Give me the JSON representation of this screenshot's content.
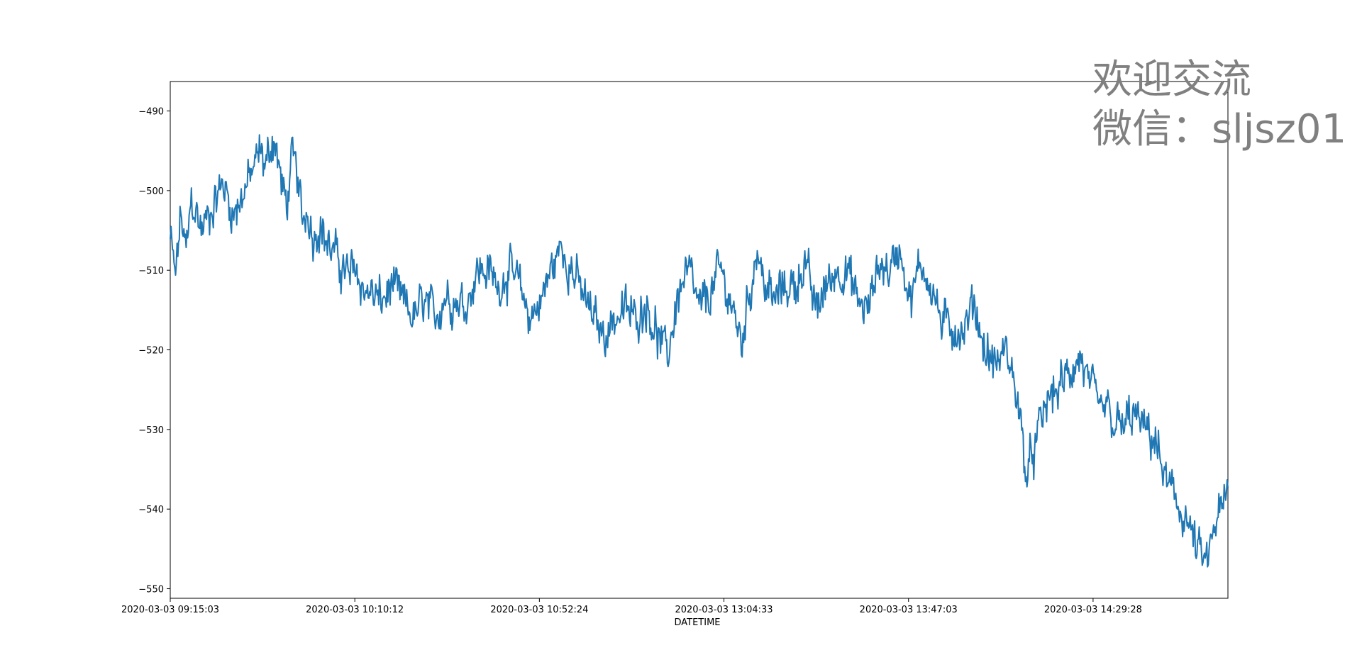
{
  "watermark": {
    "line1": "欢迎交流",
    "line2": "微信：sljsz01"
  },
  "colors": {
    "series": "#1f77b4",
    "axis": "#000000",
    "watermark": "#808080"
  },
  "chart_data": {
    "type": "line",
    "title": "",
    "xlabel": "DATETIME",
    "ylabel": "",
    "x_tick_labels": [
      "2020-03-03 09:15:03",
      "2020-03-03 10:10:12",
      "2020-03-03 10:52:24",
      "2020-03-03 13:04:33",
      "2020-03-03 13:47:03",
      "2020-03-03 14:29:28"
    ],
    "x_tick_positions": [
      0,
      0.1745,
      0.349,
      0.5235,
      0.698,
      0.8725
    ],
    "y_ticks": [
      -490,
      -500,
      -510,
      -520,
      -530,
      -540,
      -550
    ],
    "ylim": [
      -551.2,
      -486.3
    ],
    "grid": false,
    "legend": "none",
    "x_note": "x values are fractions of the plotted time span (trading-time index order)",
    "series": [
      {
        "x": [
          0,
          0.005,
          0.01,
          0.015,
          0.02,
          0.03,
          0.04,
          0.05,
          0.06,
          0.07,
          0.08,
          0.085,
          0.09,
          0.098,
          0.105,
          0.11,
          0.115,
          0.12,
          0.125,
          0.13,
          0.135,
          0.14,
          0.15,
          0.16,
          0.17,
          0.175,
          0.18,
          0.19,
          0.2,
          0.21,
          0.22,
          0.23,
          0.24,
          0.25,
          0.26,
          0.27,
          0.28,
          0.29,
          0.3,
          0.31,
          0.32,
          0.33,
          0.34,
          0.35,
          0.36,
          0.37,
          0.38,
          0.39,
          0.4,
          0.41,
          0.42,
          0.43,
          0.44,
          0.45,
          0.46,
          0.47,
          0.48,
          0.49,
          0.5,
          0.51,
          0.52,
          0.53,
          0.54,
          0.55,
          0.555,
          0.56,
          0.57,
          0.58,
          0.59,
          0.6,
          0.61,
          0.62,
          0.63,
          0.64,
          0.65,
          0.66,
          0.67,
          0.68,
          0.69,
          0.7,
          0.71,
          0.72,
          0.73,
          0.74,
          0.75,
          0.76,
          0.77,
          0.78,
          0.79,
          0.8,
          0.81,
          0.82,
          0.83,
          0.84,
          0.85,
          0.86,
          0.87,
          0.88,
          0.885,
          0.89,
          0.9,
          0.91,
          0.92,
          0.93,
          0.94,
          0.95,
          0.96,
          0.97,
          0.98,
          0.99,
          0.995,
          1.0
        ],
        "y": [
          -506,
          -511,
          -503,
          -508,
          -501,
          -505,
          -502,
          -499,
          -503,
          -500,
          -497,
          -495,
          -497,
          -493,
          -499,
          -502,
          -496,
          -498,
          -504,
          -502,
          -506,
          -504,
          -507,
          -509,
          -511,
          -509,
          -512,
          -513,
          -514,
          -512,
          -514,
          -516,
          -514,
          -516,
          -513,
          -514,
          -514,
          -510,
          -510,
          -512,
          -510,
          -512,
          -516,
          -514,
          -510,
          -507,
          -510,
          -513,
          -516,
          -518,
          -516,
          -515,
          -516,
          -514,
          -518,
          -521,
          -513,
          -510,
          -515,
          -513,
          -510,
          -514,
          -519,
          -511,
          -507,
          -511,
          -514,
          -512,
          -512,
          -509,
          -515,
          -512,
          -510,
          -510,
          -514,
          -515,
          -509,
          -510,
          -507,
          -514,
          -509,
          -512,
          -517,
          -517,
          -518,
          -514,
          -520,
          -522,
          -520,
          -525,
          -536,
          -531,
          -526,
          -525,
          -523,
          -521,
          -525,
          -528,
          -527,
          -529,
          -530,
          -528,
          -530,
          -531,
          -536,
          -539,
          -541,
          -545,
          -547,
          -541,
          -540,
          -538
        ]
      }
    ]
  }
}
